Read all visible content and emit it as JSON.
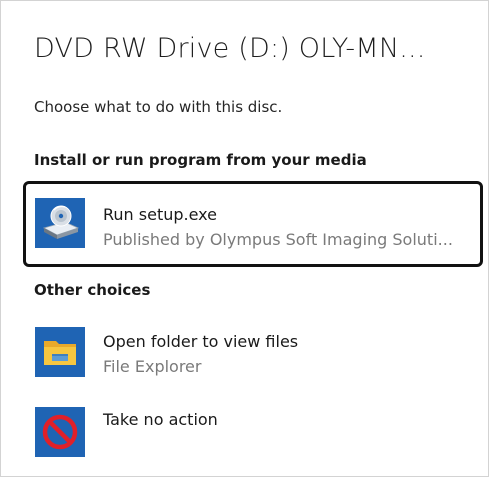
{
  "dialog": {
    "title": "DVD RW Drive (D:) OLY-MN...",
    "prompt": "Choose what to do with this disc."
  },
  "sections": {
    "install": {
      "heading": "Install or run program from your media"
    },
    "other": {
      "heading": "Other choices"
    }
  },
  "choices": {
    "run_setup": {
      "title": "Run setup.exe",
      "subtitle": "Published by Olympus Soft Imaging Soluti...",
      "icon": "disc-drive-icon"
    },
    "open_folder": {
      "title": "Open folder to view files",
      "subtitle": "File Explorer",
      "icon": "folder-icon"
    },
    "no_action": {
      "title": "Take no action",
      "icon": "prohibited-icon"
    }
  },
  "colors": {
    "tile_blue": "#1f64b4",
    "focus_border": "#111111",
    "secondary_text": "#7a7a7a",
    "prohibit_red": "#e0202a",
    "folder_yellow": "#f6c640"
  }
}
